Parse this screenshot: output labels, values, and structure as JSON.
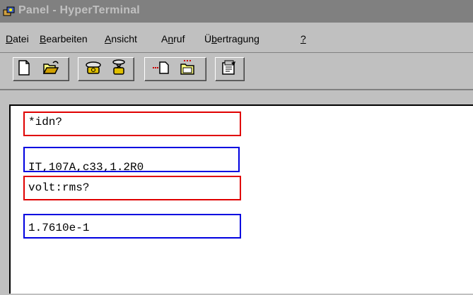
{
  "window": {
    "title": "Panel - HyperTerminal"
  },
  "menu": [
    {
      "label_pre": "",
      "label_u": "D",
      "label_post": "atei"
    },
    {
      "label_pre": "",
      "label_u": "B",
      "label_post": "earbeiten"
    },
    {
      "label_pre": "",
      "label_u": "A",
      "label_post": "nsicht"
    },
    {
      "label_pre": "A",
      "label_u": "n",
      "label_post": "ruf"
    },
    {
      "label_pre": "Ü",
      "label_u": "b",
      "label_post": "ertragung"
    },
    {
      "label_pre": "",
      "label_u": "?",
      "label_post": ""
    }
  ],
  "toolbar": {
    "icons": [
      "new-document-icon",
      "open-folder-icon",
      "connect-phone-icon",
      "disconnect-phone-icon",
      "send-file-icon",
      "receive-file-icon",
      "properties-icon"
    ]
  },
  "terminal": {
    "lines": [
      "*idn?",
      "IT,107A,c33,1.2R0",
      "volt:rms?",
      "1.7610e-1"
    ],
    "highlight_colors": {
      "command": "#e00000",
      "response": "#0000e0"
    }
  }
}
